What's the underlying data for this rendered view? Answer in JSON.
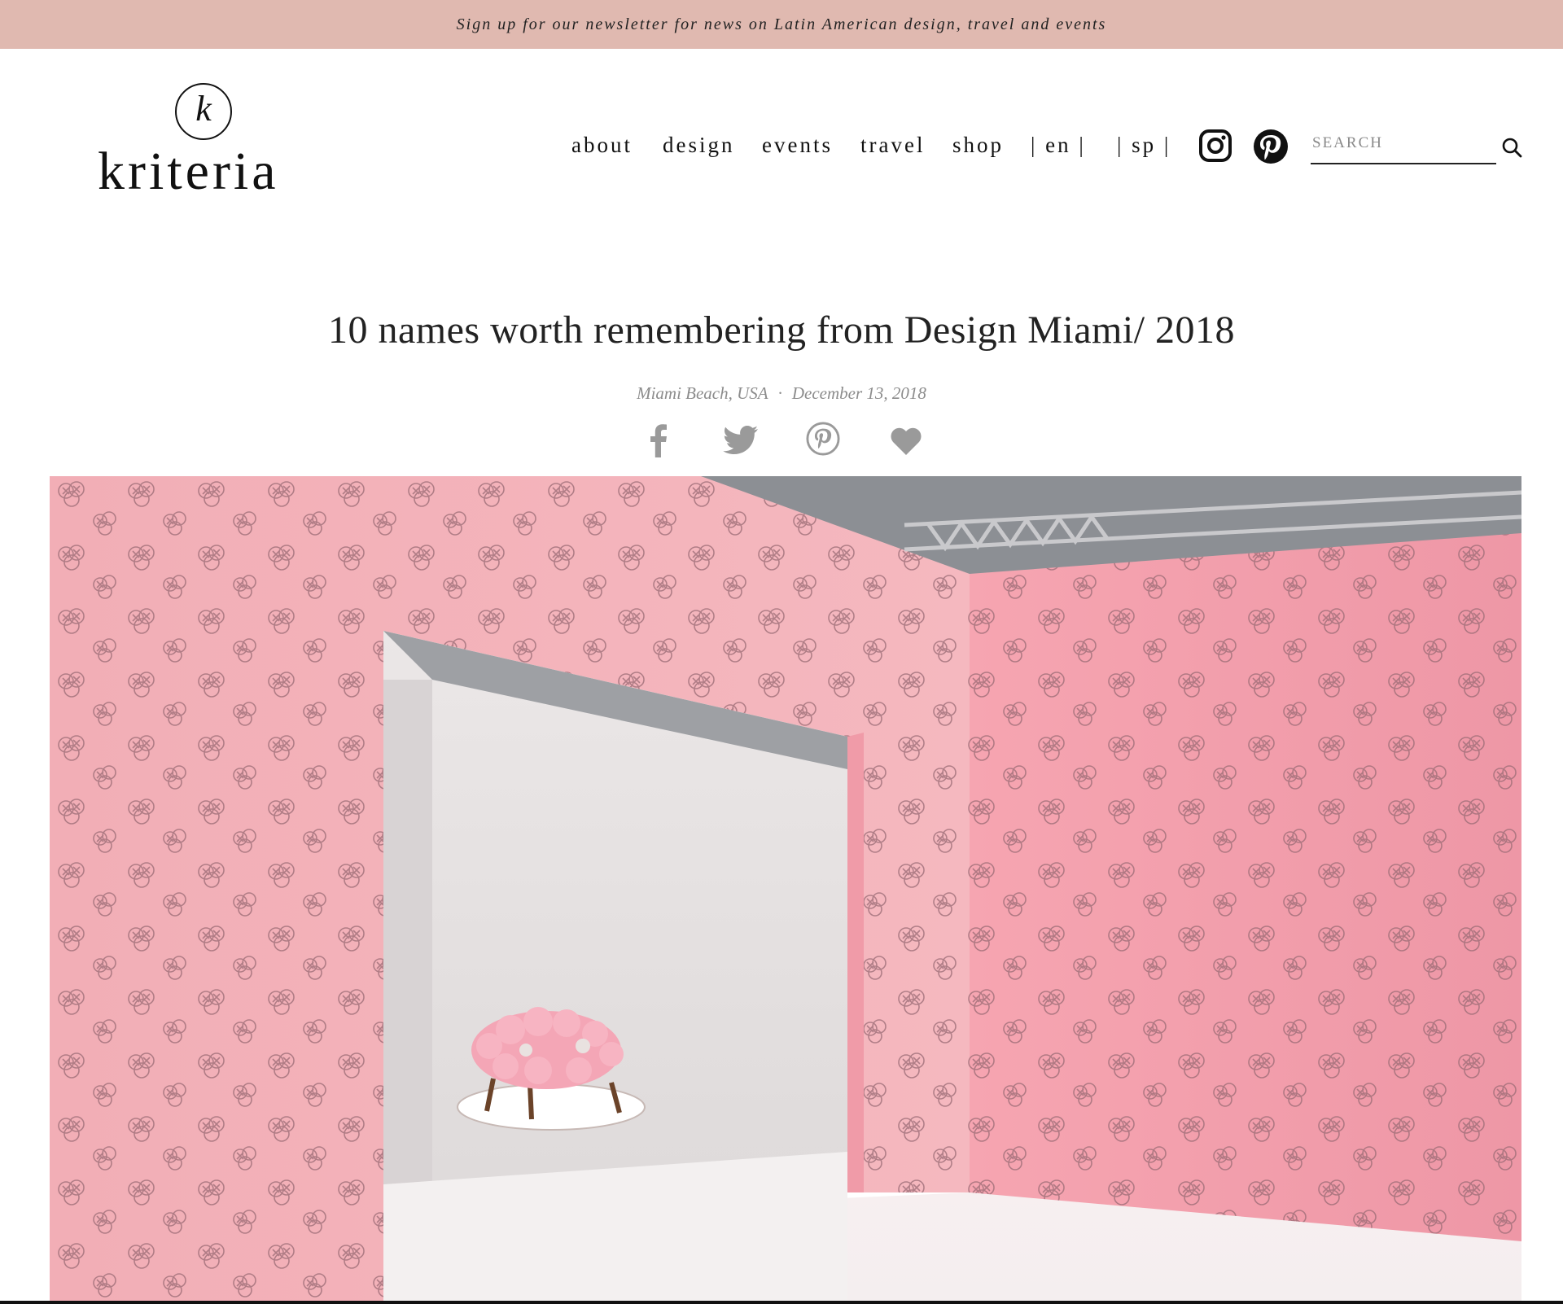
{
  "banner": {
    "text": "Sign up for our newsletter for news on Latin American design, travel and events"
  },
  "logo": {
    "monogram": "k",
    "wordmark": "kriteria"
  },
  "nav": {
    "items": [
      {
        "label": "about"
      },
      {
        "label": "design"
      },
      {
        "label": "events"
      },
      {
        "label": "travel"
      },
      {
        "label": "shop"
      }
    ],
    "lang_en": "| en |",
    "lang_sp": "| sp |"
  },
  "social": {
    "instagram_icon": "instagram-icon",
    "pinterest_icon": "pinterest-icon"
  },
  "search": {
    "placeholder": "SEARCH",
    "value": ""
  },
  "article": {
    "title": "10 names worth remembering from Design Miami/ 2018",
    "location": "Miami Beach, USA",
    "separator": "·",
    "date": "December 13, 2018"
  },
  "share": {
    "icons": [
      "facebook-icon",
      "twitter-icon",
      "pinterest-icon",
      "heart-icon"
    ],
    "color": "#999999"
  },
  "hero": {
    "wall_color": "#f2a9b4",
    "alcove_color": "#e9e6e6",
    "floor_color": "#f3eff0"
  },
  "colors": {
    "banner": "#e0b9b0",
    "text": "#111111",
    "meta": "#8c8c8c"
  }
}
